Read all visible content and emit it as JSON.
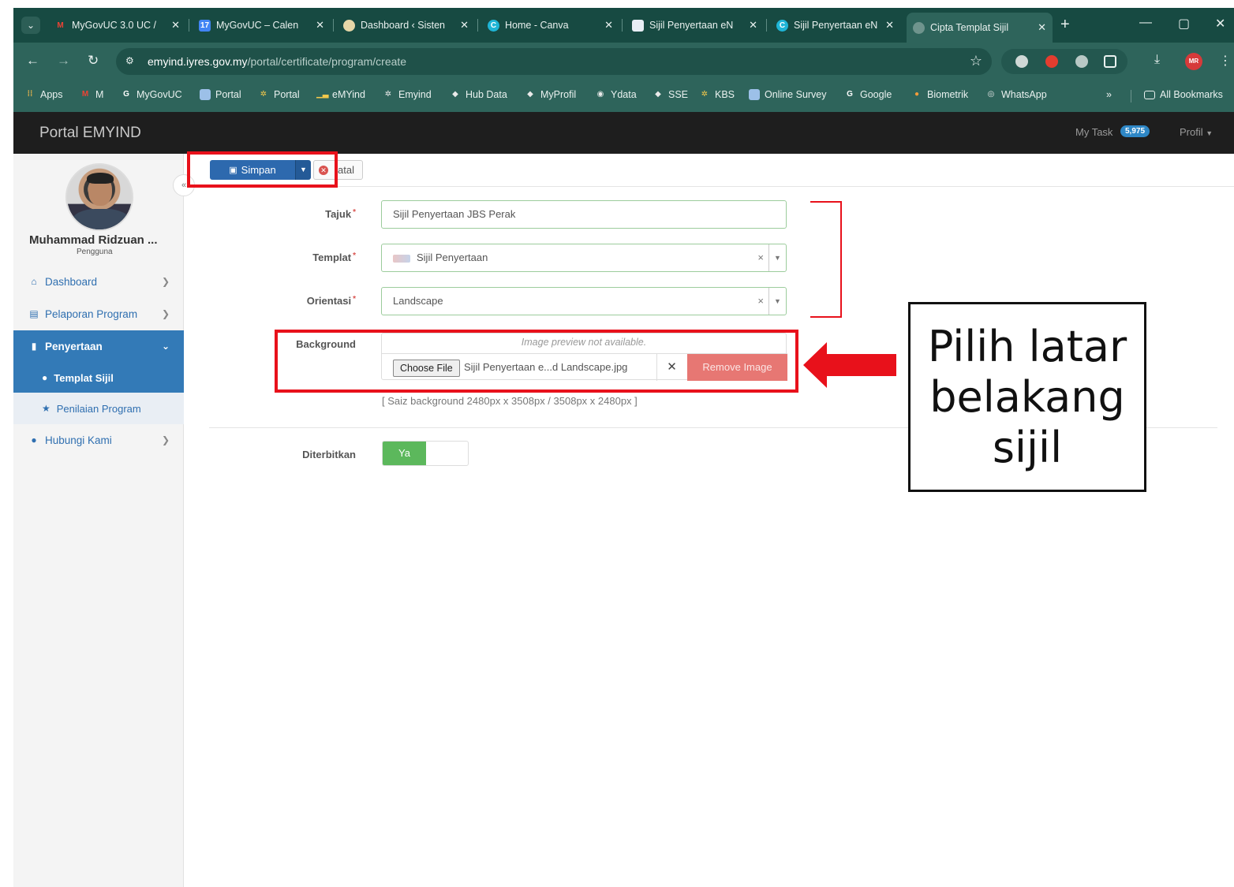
{
  "browser": {
    "tabs": [
      {
        "label": "MyGovUC 3.0 UC /",
        "favicon": "gmail-icon",
        "color": "#ea4335"
      },
      {
        "label": "MyGovUC – Calen",
        "favicon": "calendar-icon",
        "color": "#4285f4"
      },
      {
        "label": "Dashboard ‹ Sisten",
        "favicon": "emblem-icon",
        "color": "#f0f0f0"
      },
      {
        "label": "Home - Canva",
        "favicon": "canva-icon",
        "color": "#1fb5d6"
      },
      {
        "label": "Sijil Penyertaan eN",
        "favicon": "doc-icon",
        "color": "#ffffff"
      },
      {
        "label": "Sijil Penyertaan eN",
        "favicon": "canva-icon",
        "color": "#1fb5d6"
      },
      {
        "label": "Cipta Templat Sijil",
        "favicon": "globe-icon",
        "color": "#9bb7b1"
      }
    ],
    "new_tab": "+",
    "url_host": "emyind.iyres.gov.my",
    "url_path": "/portal/certificate/program/create",
    "bookmarks": [
      "Apps",
      "M",
      "MyGovUC",
      "Portal",
      "Portal",
      "eMYind",
      "Emyind",
      "Hub Data",
      "MyProfil",
      "Ydata",
      "SSE",
      "KBS",
      "Online Survey",
      "Google",
      "Biometrik",
      "WhatsApp"
    ],
    "bookmarks_more": "»",
    "all_bookmarks": "All Bookmarks",
    "avatar_initials": "MR"
  },
  "app": {
    "brand": "Portal EMYIND",
    "my_task_label": "My Task",
    "my_task_count": "5,975",
    "profile_label": "Profil"
  },
  "sidebar": {
    "user_name": "Muhammad Ridzuan ...",
    "user_role": "Pengguna",
    "collapse": "«",
    "items": [
      {
        "label": "Dashboard",
        "icon": "home-icon"
      },
      {
        "label": "Pelaporan Program",
        "icon": "book-icon"
      },
      {
        "label": "Penyertaan",
        "icon": "clipboard-icon"
      },
      {
        "label": "Hubungi Kami",
        "icon": "chat-icon"
      }
    ],
    "subitems": [
      {
        "label": "Templat Sijil",
        "icon": "circle-icon"
      },
      {
        "label": "Penilaian Program",
        "icon": "star-icon"
      }
    ]
  },
  "toolbar": {
    "save_label": "Simpan",
    "cancel_label": "atal"
  },
  "form": {
    "tajuk_label": "Tajuk",
    "tajuk_value": "Sijil Penyertaan JBS Perak",
    "templat_label": "Templat",
    "templat_value": "Sijil Penyertaan",
    "orientasi_label": "Orientasi",
    "orientasi_value": "Landscape",
    "background_label": "Background",
    "preview_text": "Image preview not available.",
    "choose_file": "Choose File",
    "file_name": "Sijil Penyertaan e...d Landscape.jpg",
    "remove_image": "Remove Image",
    "size_hint": "[ Saiz background 2480px x 3508px / 3508px x 2480px ]",
    "diterbitkan_label": "Diterbitkan",
    "diterbitkan_value": "Ya",
    "required_mark": "*"
  },
  "annotation": {
    "callout_line1": "Pilih latar",
    "callout_line2": "belakang",
    "callout_line3": "sijil",
    "color": "#e8111b"
  }
}
